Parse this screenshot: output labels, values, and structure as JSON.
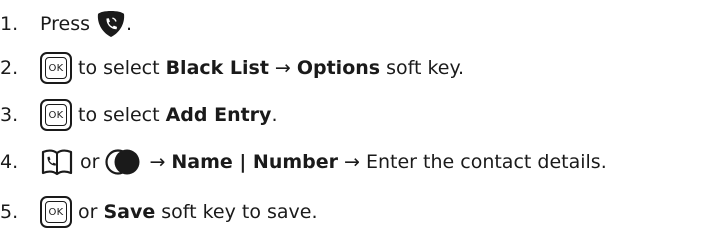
{
  "steps": [
    {
      "num": "1.",
      "parts": {
        "a": "Press",
        "b": "."
      }
    },
    {
      "num": "2.",
      "key": "OK",
      "parts": {
        "a": "to select",
        "b": "Black List",
        "c": "→",
        "d": "Options",
        "e": "soft key."
      }
    },
    {
      "num": "3.",
      "key": "OK",
      "parts": {
        "a": "to select",
        "b": "Add Entry",
        "c": "."
      }
    },
    {
      "num": "4.",
      "parts": {
        "a": "or",
        "b": "→",
        "c": "Name | Number",
        "d": "→ Enter the contact details."
      }
    },
    {
      "num": "5.",
      "key": "OK",
      "parts": {
        "a": "or",
        "b": "Save",
        "c": "soft key to save."
      }
    }
  ],
  "icons": {
    "call": "phone-handset-shield-icon",
    "phonebook": "phonebook-icon",
    "nav": "navigation-key-icon",
    "ok": "ok-key-icon"
  }
}
